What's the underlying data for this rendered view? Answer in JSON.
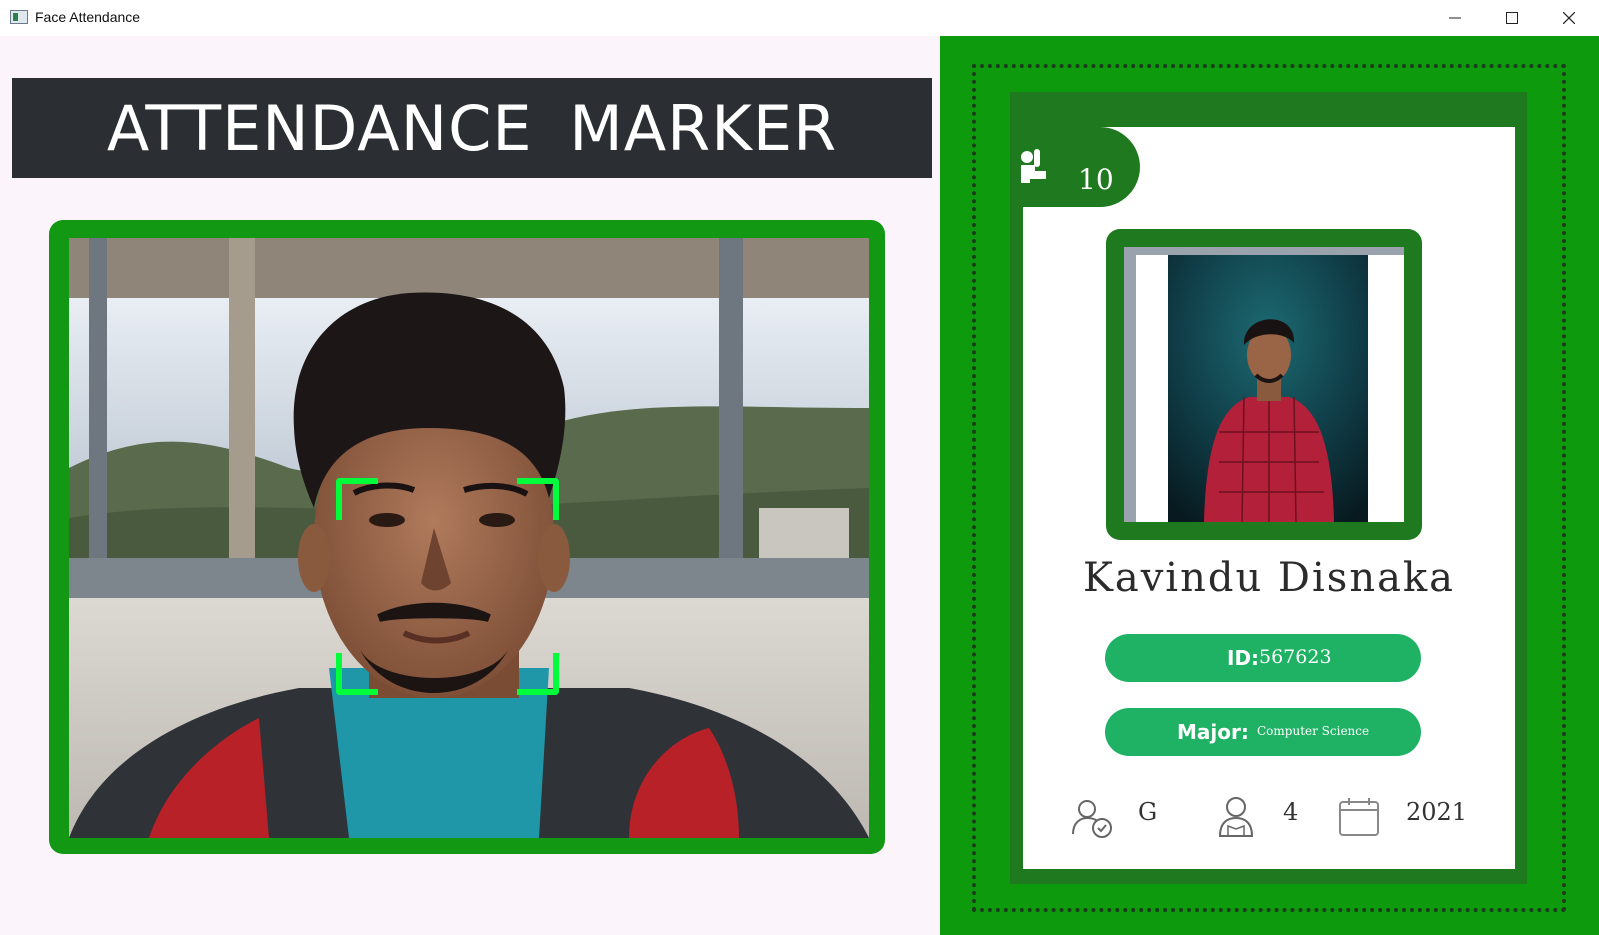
{
  "window": {
    "title": "Face Attendance",
    "minimize_icon": "minimize-icon",
    "maximize_icon": "maximize-icon",
    "close_icon": "close-icon"
  },
  "banner": {
    "title": "ATTENDANCE MARKER"
  },
  "colors": {
    "camera_frame": "#129812",
    "face_box": "#00ff3a",
    "right_panel": "#0d9a0d",
    "card_dark_green": "#1f7a1f",
    "pill_green": "#1fb265",
    "banner_bg": "#2b2f33"
  },
  "student": {
    "total_attendance": "10",
    "name": "Kavindu Disnaka",
    "id_label": "ID:",
    "id_value": "567623",
    "major_label": "Major:",
    "major_value": "Computer Science",
    "standing": "G",
    "year": "4",
    "starting_year": "2021"
  },
  "icons": {
    "attendance": "raised-hand-icon",
    "standing": "user-check-icon",
    "year": "student-icon",
    "starting_year": "calendar-icon"
  }
}
